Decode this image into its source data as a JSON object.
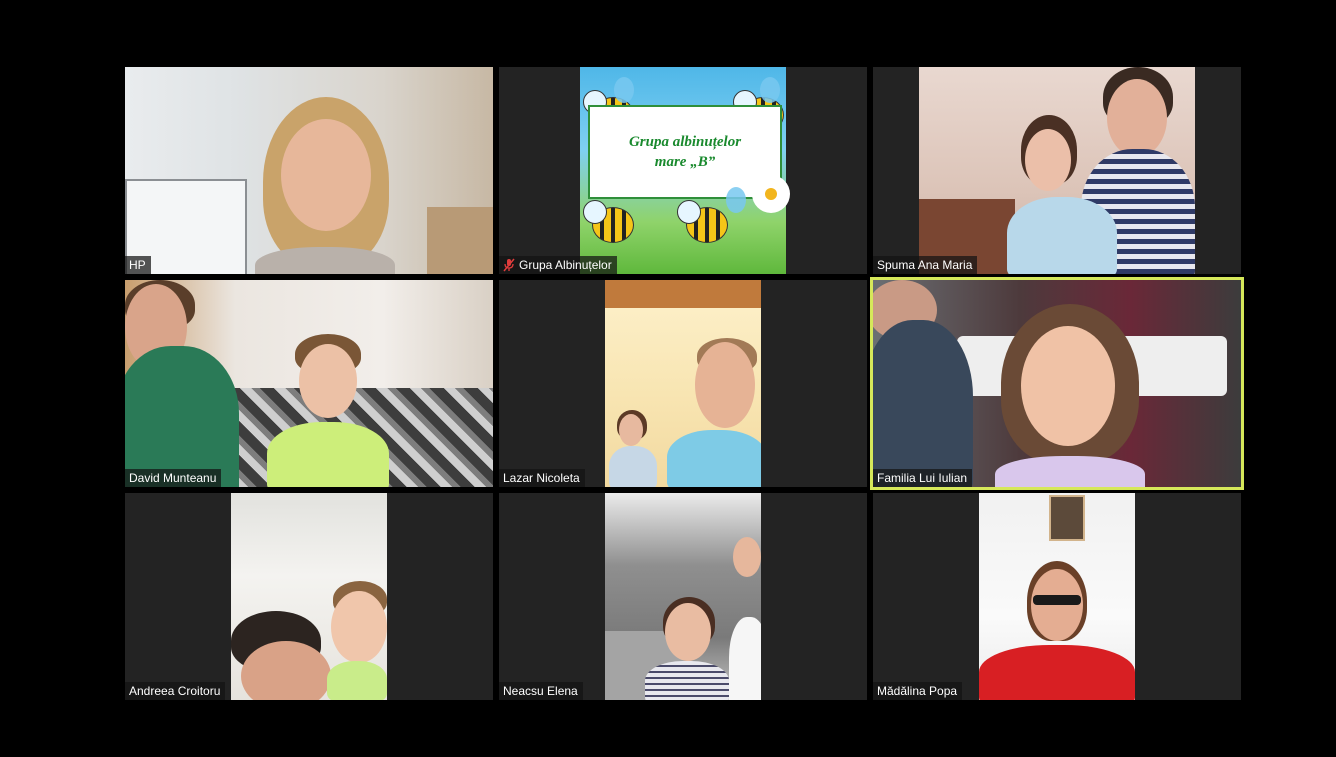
{
  "participants": [
    {
      "name": "HP",
      "muted": false,
      "active": false
    },
    {
      "name": "Grupa Albinuțelor",
      "muted": true,
      "active": false
    },
    {
      "name": "Spuma Ana Maria",
      "muted": false,
      "active": false
    },
    {
      "name": "David Munteanu",
      "muted": false,
      "active": false
    },
    {
      "name": "Lazar Nicoleta",
      "muted": false,
      "active": false
    },
    {
      "name": "Familia Lui Iulian",
      "muted": false,
      "active": true
    },
    {
      "name": "Andreea Croitoru",
      "muted": false,
      "active": false
    },
    {
      "name": "Neacsu Elena",
      "muted": false,
      "active": false
    },
    {
      "name": "Mădălina Popa",
      "muted": false,
      "active": false
    }
  ],
  "slide": {
    "line1": "Grupa albinuțelor",
    "line2": "mare „B”"
  },
  "colors": {
    "active_border": "#d6e85a",
    "tile_background": "#232323",
    "muted_icon": "#e03c3c"
  }
}
